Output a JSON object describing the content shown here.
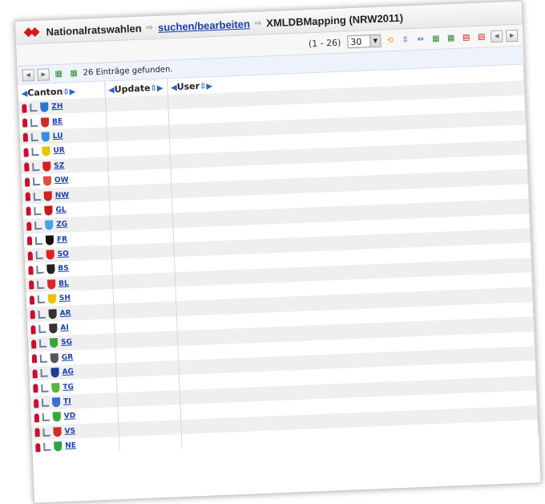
{
  "breadcrumb": {
    "app": "Nationalratswahlen",
    "link": "suchen/bearbeiten",
    "current": "XMLDBMapping (NRW2011)"
  },
  "toolbar": {
    "range": "(1 - 26)",
    "page_size": "30"
  },
  "info": {
    "found": "26 Einträge gefunden."
  },
  "columns": [
    "Canton",
    "Update",
    "User"
  ],
  "colors": {
    "link": "#1a3fb0",
    "pin": "#c8102e",
    "stripe": "#efefef"
  },
  "rows": [
    {
      "code": "ZH",
      "crest": "#2b77d6"
    },
    {
      "code": "BE",
      "crest": "#d12b2b"
    },
    {
      "code": "LU",
      "crest": "#3a8de0"
    },
    {
      "code": "UR",
      "crest": "#e5c400"
    },
    {
      "code": "SZ",
      "crest": "#d62020"
    },
    {
      "code": "OW",
      "crest": "#e84a4a"
    },
    {
      "code": "NW",
      "crest": "#cc2222"
    },
    {
      "code": "GL",
      "crest": "#c41a1a"
    },
    {
      "code": "ZG",
      "crest": "#3fa6e8"
    },
    {
      "code": "FR",
      "crest": "#111111"
    },
    {
      "code": "SO",
      "crest": "#e02020"
    },
    {
      "code": "BS",
      "crest": "#222222"
    },
    {
      "code": "BL",
      "crest": "#d42a2a"
    },
    {
      "code": "SH",
      "crest": "#f0c000"
    },
    {
      "code": "AR",
      "crest": "#333333"
    },
    {
      "code": "AI",
      "crest": "#333333"
    },
    {
      "code": "SG",
      "crest": "#3aa53a"
    },
    {
      "code": "GR",
      "crest": "#555555"
    },
    {
      "code": "AG",
      "crest": "#1d3c8f"
    },
    {
      "code": "TG",
      "crest": "#55b544"
    },
    {
      "code": "TI",
      "crest": "#3a6fd8"
    },
    {
      "code": "VD",
      "crest": "#37a837"
    },
    {
      "code": "VS",
      "crest": "#d62a2a"
    },
    {
      "code": "NE",
      "crest": "#2ea047"
    }
  ]
}
